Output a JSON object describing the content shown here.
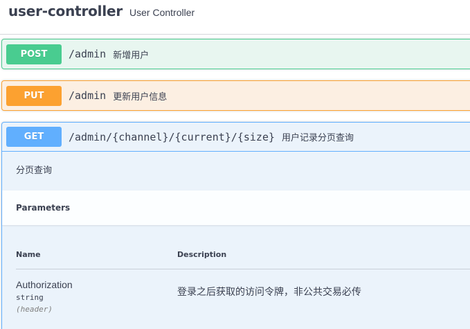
{
  "tag": {
    "name": "user-controller",
    "description": "User Controller"
  },
  "operations": [
    {
      "method": "POST",
      "path": "/admin",
      "summary": "新增用户",
      "color": "#49cc90"
    },
    {
      "method": "PUT",
      "path": "/admin",
      "summary": "更新用户信息",
      "color": "#fca130"
    },
    {
      "method": "GET",
      "path": "/admin/{channel}/{current}/{size}",
      "summary": "用户记录分页查询",
      "color": "#61affe",
      "description": "分页查询",
      "parameters_title": "Parameters",
      "columns": {
        "name": "Name",
        "description": "Description"
      },
      "parameters": [
        {
          "name": "Authorization",
          "type": "string",
          "in": "(header)",
          "description": "登录之后获取的访问令牌，非公共交易必传"
        }
      ]
    }
  ]
}
